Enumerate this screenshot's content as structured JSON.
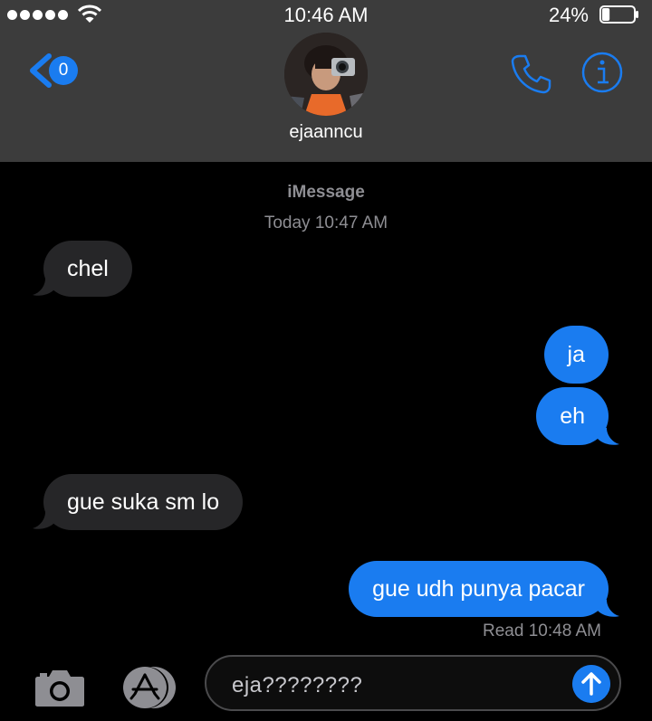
{
  "status_bar": {
    "time": "10:46 AM",
    "battery_percent": "24%",
    "battery_level": 0.24
  },
  "header": {
    "unread_count": "0",
    "contact_name": "ejaanncu"
  },
  "conversation": {
    "service_label": "iMessage",
    "timestamp": "Today 10:47 AM",
    "messages": [
      {
        "direction": "incoming",
        "text": "chel"
      },
      {
        "direction": "outgoing",
        "text": "ja"
      },
      {
        "direction": "outgoing",
        "text": "eh"
      },
      {
        "direction": "incoming",
        "text": "gue suka sm lo"
      },
      {
        "direction": "outgoing",
        "text": "gue udh punya pacar"
      }
    ],
    "read_receipt": "Read 10:48 AM"
  },
  "compose": {
    "draft_text": "eja????????"
  },
  "colors": {
    "accent": "#1a7cf0",
    "incoming_bubble": "#262628",
    "header_bg": "#3c3c3c",
    "background": "#000000"
  },
  "icons": [
    "signal-icon",
    "wifi-icon",
    "battery-icon",
    "back-chevron-icon",
    "phone-icon",
    "info-icon",
    "camera-icon",
    "app-store-icon",
    "send-arrow-icon"
  ]
}
